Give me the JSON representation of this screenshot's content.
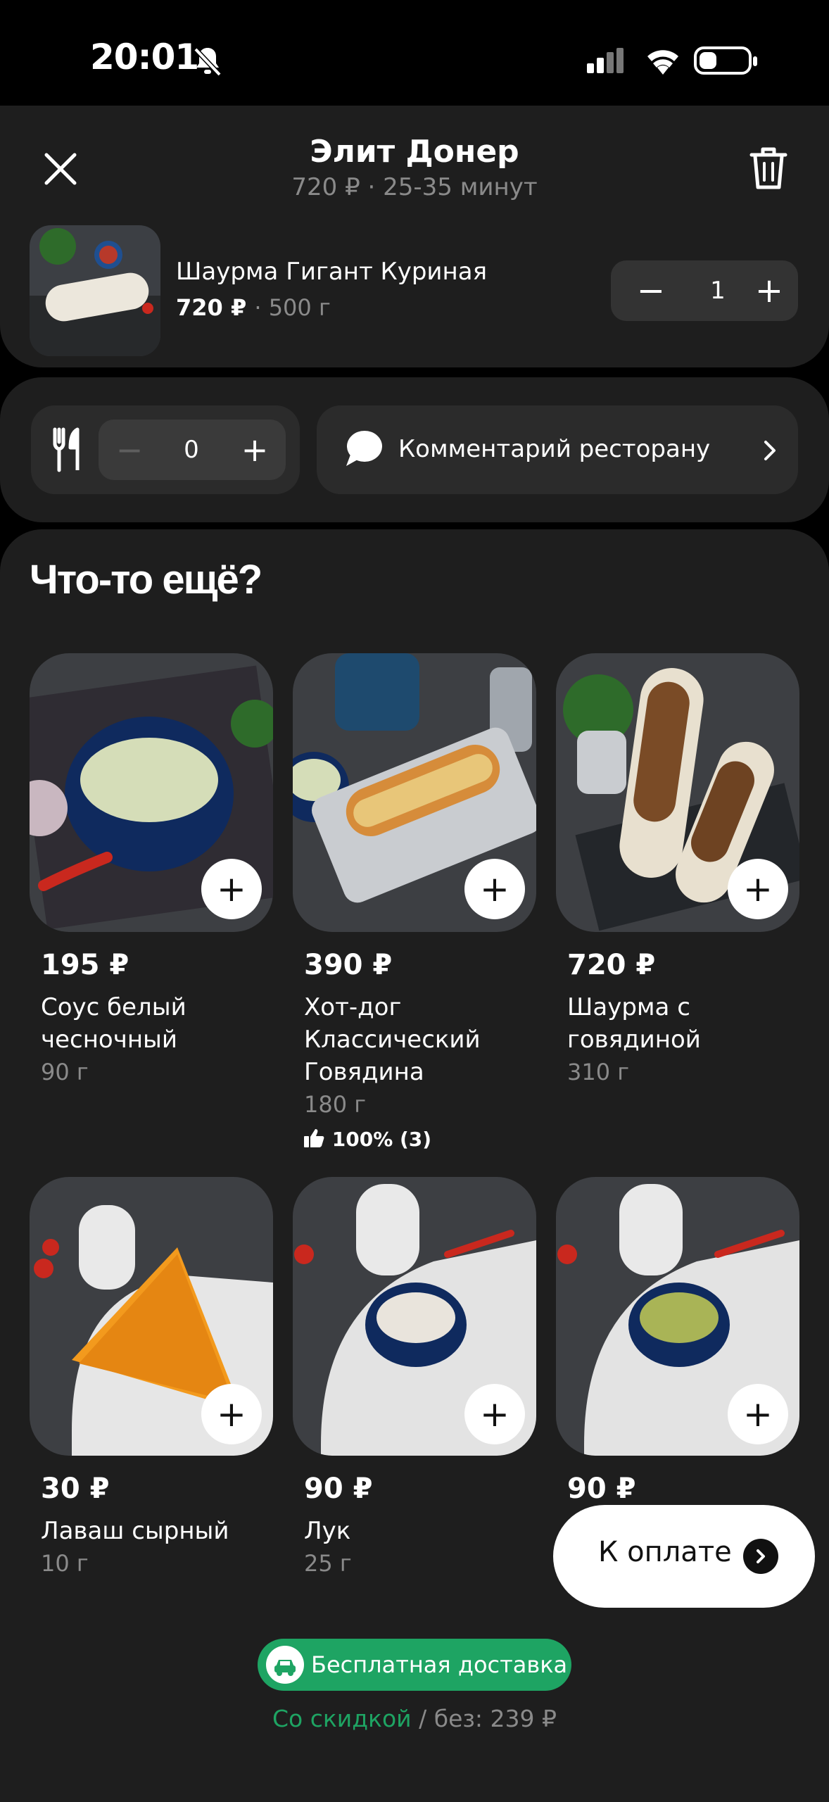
{
  "status": {
    "time": "20:01"
  },
  "header": {
    "title": "Элит Донер",
    "subtitle": "720 ₽ · 25-35 минут"
  },
  "cart_item": {
    "name": "Шаурма Гигант Куриная",
    "price": "720 ₽",
    "weight": "· 500 г",
    "quantity": "1",
    "minus": "−",
    "plus": "+"
  },
  "cutlery": {
    "count": "0",
    "minus": "−",
    "plus": "+"
  },
  "comment": {
    "label": "Комментарий ресторану"
  },
  "upsell": {
    "title": "Что-то ещё?",
    "items": [
      {
        "price": "195 ₽",
        "name": "Соус белый чесночный",
        "weight": "90 г",
        "rating": ""
      },
      {
        "price": "390 ₽",
        "name": "Хот-дог Классический Говядина",
        "weight": "180 г",
        "rating": "100% (3)"
      },
      {
        "price": "720 ₽",
        "name": "Шаурма с говядиной",
        "weight": "310 г",
        "rating": ""
      },
      {
        "price": "30 ₽",
        "name": "Лаваш сырный",
        "weight": "10 г",
        "rating": ""
      },
      {
        "price": "90 ₽",
        "name": "Лук",
        "weight": "25 г",
        "rating": ""
      },
      {
        "price": "90 ₽",
        "name": "",
        "weight": "",
        "rating": ""
      }
    ],
    "add_label": "+"
  },
  "checkout": {
    "label": "К оплате"
  },
  "delivery": {
    "badge": "Бесплатная доставка",
    "discount_label": "Со скидкой",
    "without_label": "/ без: 239 ₽"
  }
}
